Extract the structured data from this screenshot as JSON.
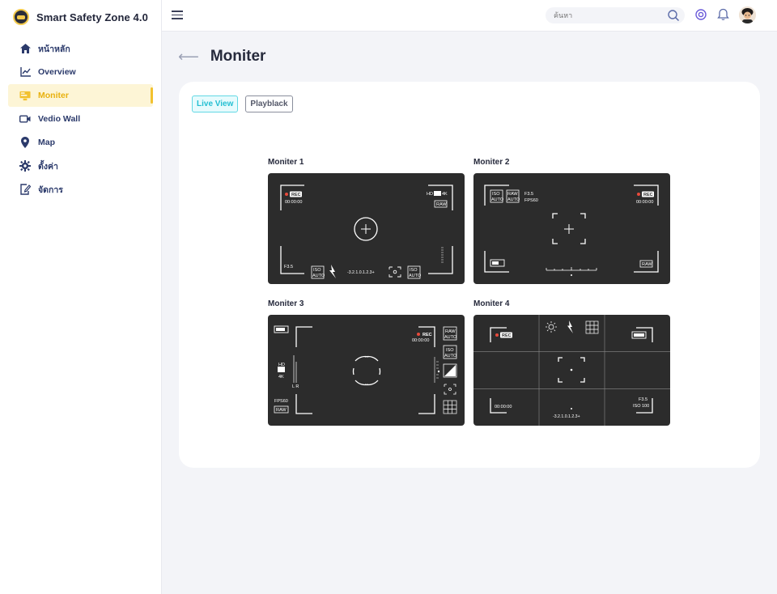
{
  "app": {
    "title": "Smart Safety Zone 4.0"
  },
  "sidebar": {
    "items": [
      {
        "label": "หน้าหลัก",
        "icon": "home-icon"
      },
      {
        "label": "Overview",
        "icon": "chart-line-icon"
      },
      {
        "label": "Moniter",
        "icon": "monitor-icon",
        "active": true
      },
      {
        "label": "Vedio Wall",
        "icon": "video-camera-icon"
      },
      {
        "label": "Map",
        "icon": "map-pin-icon"
      },
      {
        "label": "ตั้งค่า",
        "icon": "gear-icon"
      },
      {
        "label": "จัดการ",
        "icon": "edit-document-icon"
      }
    ]
  },
  "topbar": {
    "search_placeholder": "ค้นหา",
    "icons": [
      "menu-icon",
      "search-icon",
      "settings-icon",
      "bell-icon",
      "avatar"
    ]
  },
  "page": {
    "title": "Moniter",
    "back_icon": "arrow-left-icon"
  },
  "tabs": [
    {
      "label": "Live View",
      "active": true
    },
    {
      "label": "Playblack",
      "active": false
    }
  ],
  "monitors": [
    {
      "label": "Moniter 1",
      "overlay": {
        "rec": "REC",
        "time": "00:00:00",
        "hd": "HD",
        "k": "4K",
        "raw": "RAW",
        "f": "F3.5",
        "iso": "ISO",
        "auto": "AUTO",
        "scale": "-3.2.1.0.1.2.3+"
      }
    },
    {
      "label": "Moniter 2",
      "overlay": {
        "rec": "REC",
        "time": "00:00:00",
        "f": "F3.5",
        "fps": "FPS60",
        "iso": "ISO",
        "auto": "AUTO",
        "raw": "RAW"
      }
    },
    {
      "label": "Moniter 3",
      "overlay": {
        "rec": "REC",
        "time": "00:00:00",
        "fps": "FPS60",
        "raw": "RAW",
        "iso": "ISO",
        "auto": "AUTO",
        "hd": "HD",
        "k": "4K",
        "lr": "L R"
      }
    },
    {
      "label": "Moniter 4",
      "overlay": {
        "rec": "REC",
        "time": "00:00:00",
        "f": "F3.5",
        "iso": "ISO 100",
        "scale": "-3.2.1.0.1.2.3+"
      }
    }
  ],
  "colors": {
    "accent": "#f2c12e",
    "tab_active": "#23bfd2",
    "monitor_bg": "#2c2c2c"
  }
}
